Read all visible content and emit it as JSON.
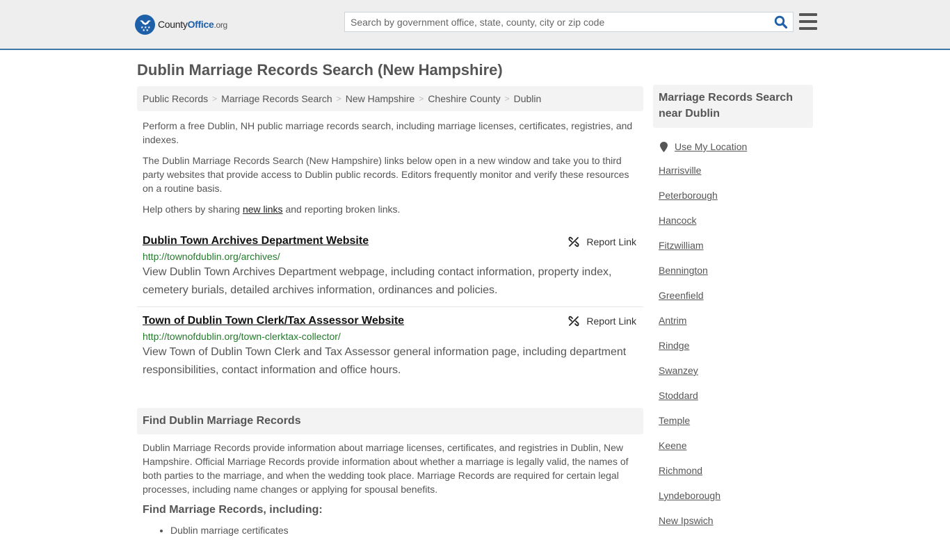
{
  "header": {
    "logo": {
      "name_part1": "County",
      "name_part2": "Office",
      "name_suffix": ".org"
    },
    "search": {
      "placeholder": "Search by government office, state, county, city or zip code",
      "value": ""
    },
    "colors": {
      "brand": "#1d5fa8",
      "accent_border": "#3d77a8"
    }
  },
  "page": {
    "title": "Dublin Marriage Records Search (New Hampshire)"
  },
  "breadcrumb": [
    {
      "label": "Public Records"
    },
    {
      "label": "Marriage Records Search"
    },
    {
      "label": "New Hampshire"
    },
    {
      "label": "Cheshire County"
    },
    {
      "label": "Dublin"
    }
  ],
  "breadcrumb_separator": ">",
  "intro": {
    "p1": "Perform a free Dublin, NH public marriage records search, including marriage licenses, certificates, registries, and indexes.",
    "p2": "The Dublin Marriage Records Search (New Hampshire) links below open in a new window and take you to third party websites that provide access to Dublin public records. Editors frequently monitor and verify these resources on a routine basis.",
    "p3_before": "Help others by sharing ",
    "p3_link": "new links",
    "p3_after": " and reporting broken links."
  },
  "listings": [
    {
      "title": "Dublin Town Archives Department Website",
      "url": "http://townofdublin.org/archives/",
      "description": "View Dublin Town Archives Department webpage, including contact information, property index, cemetery burials, detailed archives information, ordinances and policies.",
      "report_label": "Report Link"
    },
    {
      "title": "Town of Dublin Town Clerk/Tax Assessor Website",
      "url": "http://townofdublin.org/town-clerktax-collector/",
      "description": "View Town of Dublin Town Clerk and Tax Assessor general information page, including department responsibilities, contact information and office hours.",
      "report_label": "Report Link"
    }
  ],
  "find_section": {
    "heading": "Find Dublin Marriage Records",
    "body": "Dublin Marriage Records provide information about marriage licenses, certificates, and registries in Dublin, New Hampshire. Official Marriage Records provide information about whether a marriage is legally valid, the names of both parties to the marriage, and when the wedding took place. Marriage Records are required for certain legal processes, including name changes or applying for spousal benefits.",
    "subheading": "Find Marriage Records, including:",
    "bullets": [
      "Dublin marriage certificates"
    ]
  },
  "sidebar": {
    "heading": "Marriage Records Search near Dublin",
    "use_location": "Use My Location",
    "nearby": [
      "Harrisville",
      "Peterborough",
      "Hancock",
      "Fitzwilliam",
      "Bennington",
      "Greenfield",
      "Antrim",
      "Rindge",
      "Swanzey",
      "Stoddard",
      "Temple",
      "Keene",
      "Richmond",
      "Lyndeborough",
      "New Ipswich"
    ]
  }
}
